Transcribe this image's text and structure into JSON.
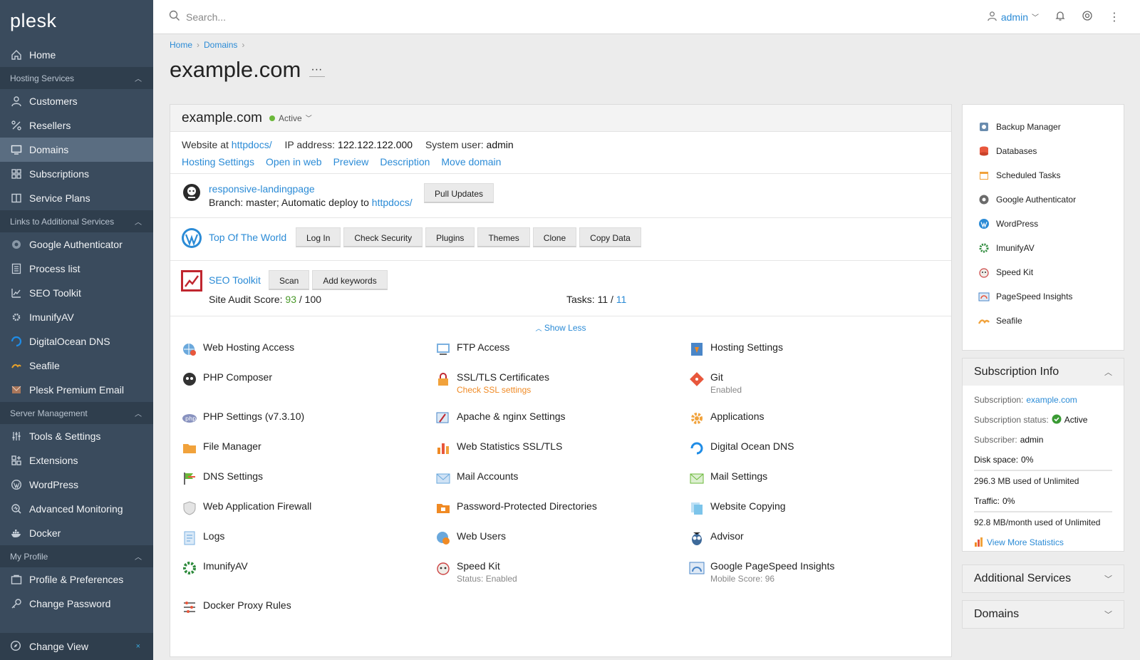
{
  "brand": "plesk",
  "sidebar": {
    "home": "Home",
    "groups": [
      {
        "label": "Hosting Services",
        "items": [
          "Customers",
          "Resellers",
          "Domains",
          "Subscriptions",
          "Service Plans"
        ]
      },
      {
        "label": "Links to Additional Services",
        "items": [
          "Google Authenticator",
          "Process list",
          "SEO Toolkit",
          "ImunifyAV",
          "DigitalOcean DNS",
          "Seafile",
          "Plesk Premium Email"
        ]
      },
      {
        "label": "Server Management",
        "items": [
          "Tools & Settings",
          "Extensions",
          "WordPress",
          "Advanced Monitoring",
          "Docker"
        ]
      },
      {
        "label": "My Profile",
        "items": [
          "Profile & Preferences",
          "Change Password"
        ]
      }
    ],
    "change_view": "Change View"
  },
  "topbar": {
    "search_placeholder": "Search...",
    "user": "admin"
  },
  "breadcrumb": [
    "Home",
    "Domains"
  ],
  "page_title": "example.com",
  "page_title_more": "···",
  "domain_card": {
    "name": "example.com",
    "status": "Active",
    "website_at_label": "Website at",
    "website_at_value": "httpdocs/",
    "ip_label": "IP address:",
    "ip_value": "122.122.122.000",
    "sysuser_label": "System user:",
    "sysuser_value": "admin",
    "links": [
      "Hosting Settings",
      "Open in web",
      "Preview",
      "Description",
      "Move domain"
    ],
    "git": {
      "repo": "responsive-landingpage",
      "branch_text": "Branch: master; Automatic deploy to",
      "deploy_path": "httpdocs/",
      "button": "Pull Updates"
    },
    "wordpress": {
      "site": "Top Of The World",
      "buttons": [
        "Log In",
        "Check Security",
        "Plugins",
        "Themes",
        "Clone",
        "Copy Data"
      ]
    },
    "seo": {
      "name": "SEO Toolkit",
      "buttons": [
        "Scan",
        "Add keywords"
      ],
      "audit_label": "Site Audit Score:",
      "audit_score": "93",
      "audit_total": "/ 100",
      "tasks_label": "Tasks:",
      "tasks_done": "11 /",
      "tasks_total": "11"
    },
    "show_less": "Show Less"
  },
  "tools": [
    {
      "label": "Web Hosting Access",
      "icon": "globe-user-icon"
    },
    {
      "label": "FTP Access",
      "icon": "ftp-icon"
    },
    {
      "label": "Hosting Settings",
      "icon": "hosting-settings-icon"
    },
    {
      "label": "PHP Composer",
      "icon": "composer-icon"
    },
    {
      "label": "SSL/TLS Certificates",
      "icon": "lock-icon",
      "sub": "Check SSL settings",
      "warn": true
    },
    {
      "label": "Git",
      "icon": "git-icon",
      "sub": "Enabled"
    },
    {
      "label": "PHP Settings (v7.3.10)",
      "icon": "php-icon"
    },
    {
      "label": "Apache & nginx Settings",
      "icon": "apache-icon"
    },
    {
      "label": "Applications",
      "icon": "gear-icon"
    },
    {
      "label": "File Manager",
      "icon": "folder-icon"
    },
    {
      "label": "Web Statistics SSL/TLS",
      "icon": "stats-icon"
    },
    {
      "label": "Digital Ocean DNS",
      "icon": "digitalocean-icon"
    },
    {
      "label": "DNS Settings",
      "icon": "dns-icon"
    },
    {
      "label": "Mail Accounts",
      "icon": "mail-icon"
    },
    {
      "label": "Mail Settings",
      "icon": "mail-settings-icon"
    },
    {
      "label": "Web Application Firewall",
      "icon": "shield-icon"
    },
    {
      "label": "Password-Protected Directories",
      "icon": "protected-folder-icon"
    },
    {
      "label": "Website Copying",
      "icon": "copy-icon"
    },
    {
      "label": "Logs",
      "icon": "logs-icon"
    },
    {
      "label": "Web Users",
      "icon": "web-users-icon"
    },
    {
      "label": "Advisor",
      "icon": "advisor-owl-icon"
    },
    {
      "label": "ImunifyAV",
      "icon": "imunify-icon"
    },
    {
      "label": "Speed Kit",
      "icon": "speedkit-icon",
      "sub": "Status: Enabled"
    },
    {
      "label": "Google PageSpeed Insights",
      "icon": "pagespeed-icon",
      "sub": "Mobile Score: 96"
    },
    {
      "label": "Docker Proxy Rules",
      "icon": "docker-proxy-icon"
    }
  ],
  "quick_links": [
    "Backup Manager",
    "Databases",
    "Scheduled Tasks",
    "Google Authenticator",
    "WordPress",
    "ImunifyAV",
    "Speed Kit",
    "PageSpeed Insights",
    "Seafile"
  ],
  "subscription_info": {
    "title": "Subscription Info",
    "subscription_label": "Subscription:",
    "subscription_value": "example.com",
    "status_label": "Subscription status:",
    "status_value": "Active",
    "subscriber_label": "Subscriber:",
    "subscriber_value": "admin",
    "disk_label": "Disk space:",
    "disk_value": "0%",
    "disk_used": "296.3 MB used of Unlimited",
    "traffic_label": "Traffic:",
    "traffic_value": "0%",
    "traffic_used": "92.8 MB/month used of Unlimited",
    "more_stats": "View More Statistics"
  },
  "panels": {
    "additional": "Additional Services",
    "domains": "Domains"
  },
  "colors": {
    "sidebar_bg": "#3a4b5d",
    "link": "#2b8bd6",
    "active_green": "#6bb83a",
    "warn": "#f08a24"
  }
}
